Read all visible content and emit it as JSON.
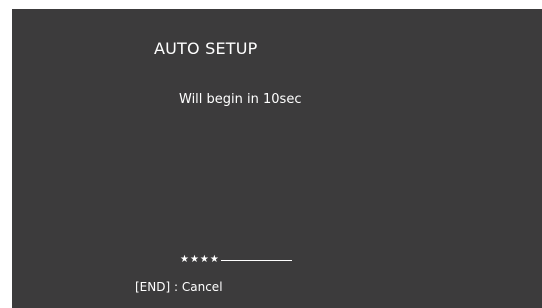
{
  "dialog": {
    "title": "AUTO SETUP",
    "countdown_text": "Will begin in 10sec"
  },
  "progress": {
    "indicator": "★★★★",
    "filled_steps": 4
  },
  "hint": {
    "key": "[END]",
    "separator": ":",
    "action": "Cancel"
  },
  "colors": {
    "background": "#3c3b3c",
    "text": "#ffffff"
  }
}
